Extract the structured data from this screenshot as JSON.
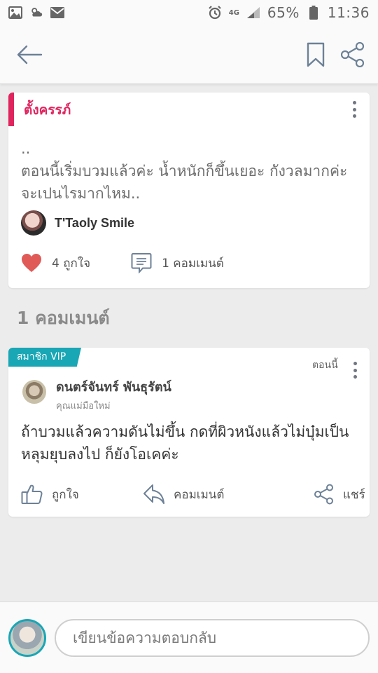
{
  "status_bar": {
    "network": "4G",
    "battery": "65%",
    "time": "11:36"
  },
  "post": {
    "category": "ตั้งครรภ์",
    "body": "..\nตอนนี้เริ่มบวมแล้วค่ะ น้ำหนักก็ขึ้นเยอะ กังวลมากค่ะ จะเปนไรมากไหม..",
    "author": "T'Taoly Smile",
    "likes_label": "4 ถูกใจ",
    "comments_label": "1 คอมเมนต์"
  },
  "comments_heading": "1 คอมเมนต์",
  "comment": {
    "badge": "สมาชิก VIP",
    "time": "ตอนนี้",
    "author": "ดนตร์จันทร์ พันธุรัตน์",
    "tag": "คุณแม่มือใหม่",
    "body": "ถ้าบวมแล้วความดันไม่ขึ้น กดที่ผิวหนังแล้วไม่บุ๋มเป็นหลุมยุบลงไป ก็ยังโอเคค่ะ",
    "like_label": "ถูกใจ",
    "comment_label": "คอมเมนต์",
    "share_label": "แชร์"
  },
  "reply": {
    "placeholder": "เขียนข้อความตอบกลับ"
  },
  "colors": {
    "accent_pink": "#e0245e",
    "accent_teal": "#19a6b5",
    "heart": "#e05a57"
  }
}
